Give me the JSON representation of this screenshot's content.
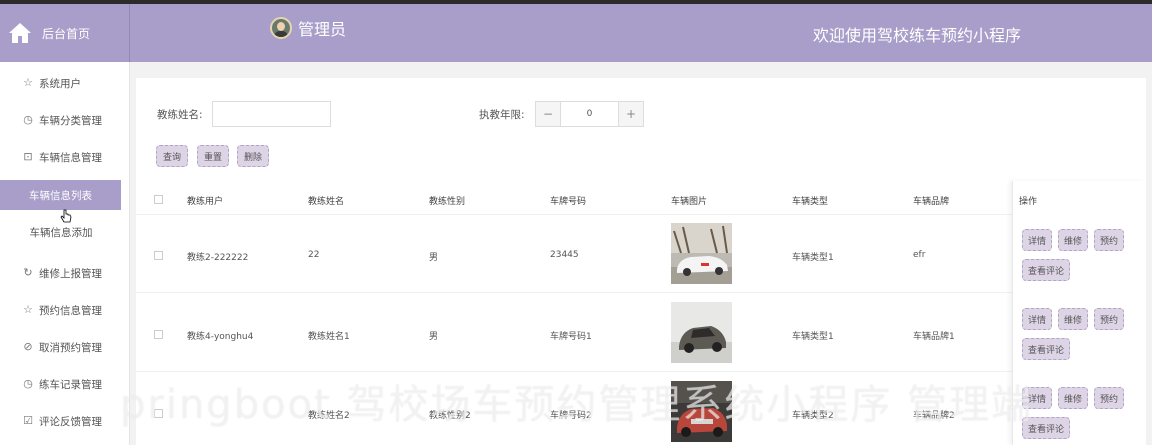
{
  "header": {
    "home_label": "后台首页",
    "admin_name": "管理员",
    "welcome": "欢迎使用驾校练车预约小程序"
  },
  "sidebar": {
    "items": [
      {
        "label": "系统用户",
        "icon": "star-icon"
      },
      {
        "label": "车辆分类管理",
        "icon": "clock-icon"
      },
      {
        "label": "车辆信息管理",
        "icon": "trash-icon"
      },
      {
        "label": "车辆信息列表",
        "sub": true,
        "active": true
      },
      {
        "label": "车辆信息添加",
        "sub": true
      },
      {
        "label": "维修上报管理",
        "icon": "refresh-icon"
      },
      {
        "label": "预约信息管理",
        "icon": "star-icon"
      },
      {
        "label": "取消预约管理",
        "icon": "check-circle-icon"
      },
      {
        "label": "练车记录管理",
        "icon": "clock-icon"
      },
      {
        "label": "评论反馈管理",
        "icon": "checkbox-icon"
      }
    ]
  },
  "search": {
    "coach_name_label": "教练姓名:",
    "coach_name_value": "",
    "years_label": "执教年限:",
    "years_value": "0",
    "minus": "−",
    "plus": "+",
    "query_button": "查询",
    "reset_button": "重置",
    "delete_button": "删除"
  },
  "table": {
    "headers": [
      "教练用户",
      "教练姓名",
      "教练性别",
      "车牌号码",
      "车辆图片",
      "车辆类型",
      "车辆品牌",
      "操作"
    ],
    "rows": [
      {
        "user": "教练2-222222",
        "name": "22",
        "gender": "男",
        "plate": "23445",
        "type": "车辆类型1",
        "brand": "efr"
      },
      {
        "user": "教练4-yonghu4",
        "name": "教练姓名1",
        "gender": "男",
        "plate": "车牌号码1",
        "type": "车辆类型1",
        "brand": "车辆品牌1"
      },
      {
        "user": "",
        "name": "教练姓名2",
        "gender": "教练性别2",
        "plate": "车牌号码2",
        "type": "车辆类型2",
        "brand": "车辆品牌2"
      }
    ],
    "actions": {
      "detail": "详情",
      "repair": "维修",
      "reserve": "预约",
      "comments": "查看评论"
    }
  },
  "watermark": "pringboot 驾校场车预约管理系统小程序 管理端",
  "colors": {
    "accent": "#a89ec9",
    "button_bg": "#ddd4e6"
  }
}
